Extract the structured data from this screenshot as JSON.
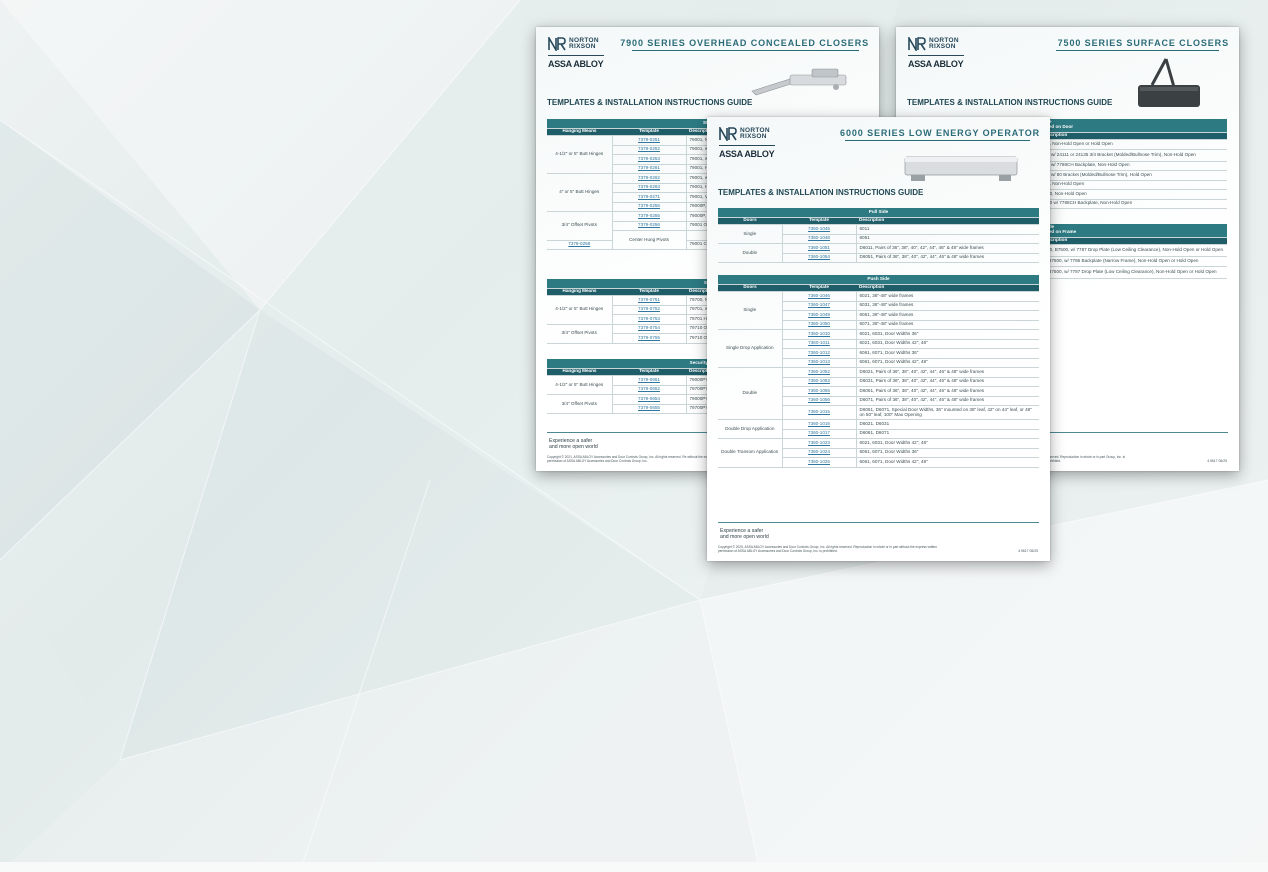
{
  "brand": {
    "logo_line1": "NORTON",
    "logo_line2": "RIXSON",
    "logo_parent": "ASSA ABLOY"
  },
  "colors": {
    "accent_teal": "#2d7a83",
    "header_dark": "#1f5e69",
    "link_blue": "#2f77a1",
    "title_teal": "#2a6b78"
  },
  "icons": {
    "logo_mark": "nr-monogram-icon",
    "product_7900": "concealed-closer-arm-icon",
    "product_7500": "surface-closer-icon",
    "product_6000": "low-energy-operator-icon"
  },
  "sheet_left": {
    "series_title": "7900 SERIES OVERHEAD CONCEALED CLOSERS",
    "guide_title": "TEMPLATES & INSTALLATION INSTRUCTIONS GUIDE",
    "table1": {
      "banner": "Standard",
      "headers": [
        "Hanging Means",
        "Template",
        "Descripti"
      ],
      "rows": [
        {
          "group": "4-1/2\" or 5\" Butt Hinges",
          "span": 4,
          "template": "7379-0251",
          "desc": "79001, N"
        },
        {
          "template": "7379-0252",
          "desc": "79001, w"
        },
        {
          "template": "7379-0253",
          "desc": "79001, w"
        },
        {
          "template": "7379-0261",
          "desc": "79001, H"
        },
        {
          "group": "4\" or 5\" Butt Hinges",
          "span": 4,
          "template": "7379-0262",
          "desc": "79001, w Frame"
        },
        {
          "template": "7379-0263",
          "desc": "79001, H"
        },
        {
          "template": "7379-0271",
          "desc": "79001, V Frame"
        },
        {
          "template": "7379-0256",
          "desc": "79000P,"
        },
        {
          "group": "3/4\" Offset Pivots",
          "span": 3,
          "template": "7379-0255",
          "desc": "79000P,"
        },
        {
          "template": "7379-0256",
          "desc": "79001 O"
        },
        {
          "group": "Center Hung Pivots",
          "span": 2,
          "template": "7379-0257",
          "desc": "79000C,"
        },
        {
          "template": "7379-0258",
          "desc": "79001 C"
        }
      ]
    },
    "table2": {
      "banner": "Security",
      "headers": [
        "Hanging Means",
        "Template",
        "Descripti"
      ],
      "rows": [
        {
          "group": "4-1/2\" or 5\" Butt Hinges",
          "span": 3,
          "template": "7379-0751",
          "desc": "79700, N"
        },
        {
          "template": "7379-0752",
          "desc": "79701, w"
        },
        {
          "template": "7379-0753",
          "desc": "79701 H"
        },
        {
          "group": "3/4\" Offset Pivots",
          "span": 2,
          "template": "7379-0754",
          "desc": "79710 OP"
        },
        {
          "template": "7379-0755",
          "desc": "79710 OP"
        }
      ]
    },
    "table3": {
      "banner": "Security Closers with",
      "headers": [
        "Hanging Means",
        "Template",
        "Descripti"
      ],
      "rows": [
        {
          "group": "4-1/2\" or 5\" Butt Hinges",
          "span": 2,
          "template": "7379-0651",
          "desc": "79000PY"
        },
        {
          "template": "7379-0652",
          "desc": "79700PY"
        },
        {
          "group": "3/4\" Offset Pivots",
          "span": 2,
          "template": "7379-0654",
          "desc": "79000PY"
        },
        {
          "template": "7379-0655",
          "desc": "79700PY"
        }
      ]
    },
    "footer_line1": "Experience a safer",
    "footer_line2": "and more open world",
    "copyright": "Copyright © 2021, ASSA ABLOY Accessories and Door Controls Group, Inc. All rights reserved. Re without the express written permission of ASSA ABLOY Accessories and Door Controls Group, Inc."
  },
  "sheet_right": {
    "series_title": "7500 SERIES SURFACE CLOSERS",
    "guide_title": "TEMPLATES & INSTALLATION INSTRUCTIONS GUIDE",
    "table1": {
      "banner_l1": "Pull Side",
      "banner_l2": "r Mounted on Door",
      "header": "Description",
      "rows": [
        "500, Non-Hold Open or Hold Open",
        "500 w/ 24111 or 24135 3/4 Bracket (Molded/Bullnose Trim), Non-Hold Open",
        "500 w/ 7788CH Backplate, Non-Hold Open",
        "500 w/ 80 Bracket (Molded/Bullnose Trim), Hold Open",
        "180, Non-Hold Open",
        "7500, Non-Hold Open",
        "7500 w/ 7788CH Backplate, Non-Hold Open"
      ]
    },
    "table2": {
      "banner_l1": "Push Side",
      "banner_l2": "r Mounted on Frame",
      "header": "Description",
      "rows": [
        "7500, B7500, w/ 7787 Drop Plate (Low Ceiling Clearance), Non-Hold Open or Hold Open",
        "PA 37500, w/ 7786 Backplate (Narrow Frame), Non-Hold Open or Hold Open",
        "PA 37500, w/ 7787 Drop Plate (Low Ceiling Clearance), Non-Hold Open or Hold Open"
      ]
    },
    "copyright": "reserved. Reproduction in whole or in part Group, Inc. is prohibited.",
    "code": "4.9617 06/25"
  },
  "sheet_front": {
    "series_title": "6000 SERIES LOW ENERGY OPERATOR",
    "guide_title": "TEMPLATES & INSTALLATION INSTRUCTIONS GUIDE",
    "pull": {
      "banner": "Pull Side",
      "headers": [
        "Doors",
        "Template",
        "Description"
      ],
      "rows": [
        {
          "group": "Single",
          "span": 2,
          "template": "7360-1045",
          "desc": "6011"
        },
        {
          "template": "7360-1048",
          "desc": "6051"
        },
        {
          "group": "Double",
          "span": 2,
          "template": "7360-1051",
          "desc": "D6011, Pairs of 36\", 38\", 40\", 42\", 44\", 46\" & 48\" wide frames"
        },
        {
          "template": "7360-1054",
          "desc": "D6051, Pairs of 36\", 38\", 40\", 42\", 44\", 46\" & 48\" wide frames"
        }
      ]
    },
    "push": {
      "banner": "Push Side",
      "headers": [
        "Doors",
        "Template",
        "Description"
      ],
      "rows": [
        {
          "group": "Single",
          "span": 4,
          "template": "7360-1046",
          "desc": "6021, 36\"-48\" wide frames"
        },
        {
          "template": "7360-1047",
          "desc": "6031, 36\"-48\" wide frames"
        },
        {
          "template": "7360-1049",
          "desc": "6061, 36\"-48\" wide frames"
        },
        {
          "template": "7360-1050",
          "desc": "6071, 36\"-48\" wide frames"
        },
        {
          "group": "Single Drop Application",
          "span": 4,
          "template": "7360-1010",
          "desc": "6021, 6031, Door Widths 36\""
        },
        {
          "template": "7360-1011",
          "desc": "6021, 6031, Door Widths 42\", 48\""
        },
        {
          "template": "7360-1012",
          "desc": "6061, 6071, Door Widths 36\""
        },
        {
          "template": "7360-1013",
          "desc": "6061, 6071, Door Widths 42\", 48\""
        },
        {
          "group": "Double",
          "span": 5,
          "template": "7360-1052",
          "desc": "D6021, Pairs of 36\", 38\", 40\", 42\", 44\", 46\" & 48\" wide frames"
        },
        {
          "template": "7360-1053",
          "desc": "D6031, Pairs of 36\", 38\", 40\", 42\", 44\", 46\" & 48\" wide frames"
        },
        {
          "template": "7360-1055",
          "desc": "D6061, Pairs of 36\", 38\", 40\", 42\", 44\", 46\" & 48\" wide frames"
        },
        {
          "template": "7360-1056",
          "desc": "D6071, Pairs of 36\", 38\", 40\", 42\", 44\", 46\" & 48\" wide frames"
        },
        {
          "template": "7360-1015",
          "desc": "D6061, D6071, Special Door Widths, 36\" mounted on 38\" leaf, 42\" on 44\" leaf, or 48\" on 50\" leaf, 100\" Max Opening",
          "tall": true
        },
        {
          "group": "Double Drop Application",
          "span": 2,
          "template": "7360-1016",
          "desc": "D6021, D6031"
        },
        {
          "template": "7360-1017",
          "desc": "D6061, D6071"
        },
        {
          "group": "Double Transom Application",
          "span": 4,
          "template": "7360-1023",
          "desc": "6021, 6031, Door Widths 42\", 48\""
        },
        {
          "template": "7360-1024",
          "desc": "6061, 6071, Door Widths 36\""
        },
        {
          "template": "7360-1025",
          "desc": "6061, 6071, Door Widths 42\", 48\""
        }
      ]
    },
    "footer_line1": "Experience a safer",
    "footer_line2": "and more open world",
    "copyright": "Copyright © 2025, ASSA ABLOY Accessories and Door Controls Group, Inc. All rights reserved. Reproduction in whole or in part without the express written permission of ASSA ABLOY Accessories and Door Controls Group, Inc. is prohibited.",
    "code": "4.9617 06/25"
  }
}
